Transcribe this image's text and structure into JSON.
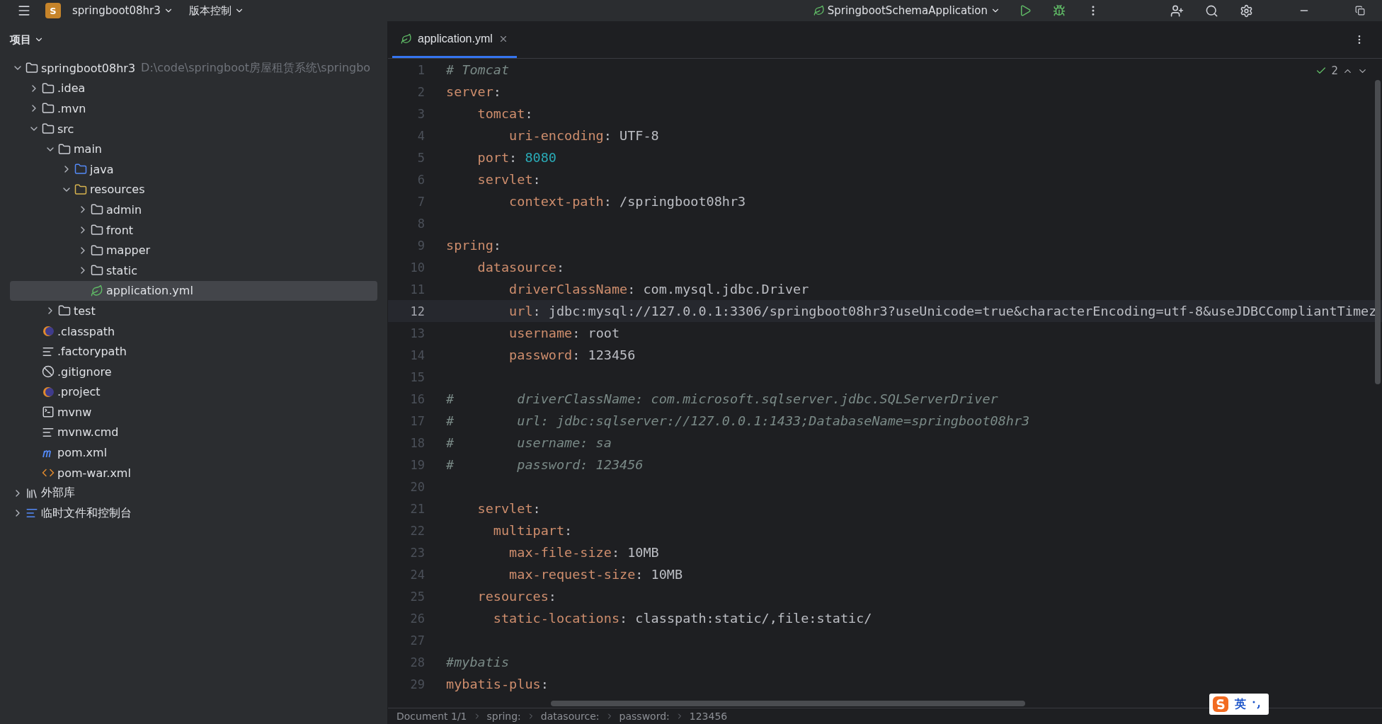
{
  "title_bar": {
    "project_badge": "S",
    "project": "springboot08hr3",
    "vcs": "版本控制",
    "run_config": "SpringbootSchemaApplication"
  },
  "sidebar": {
    "title": "项目",
    "tree": [
      {
        "label": "springboot08hr3",
        "hint": "D:\\code\\springboot房屋租赁系统\\springbo",
        "kind": "module",
        "expanded": true,
        "selected": false,
        "children": [
          {
            "label": ".idea",
            "kind": "folder",
            "expanded": false,
            "selected": false
          },
          {
            "label": ".mvn",
            "kind": "folder",
            "expanded": false,
            "selected": false
          },
          {
            "label": "src",
            "kind": "folder",
            "expanded": true,
            "selected": false,
            "children": [
              {
                "label": "main",
                "kind": "folder",
                "expanded": true,
                "selected": false,
                "children": [
                  {
                    "label": "java",
                    "kind": "source",
                    "expanded": false,
                    "selected": false
                  },
                  {
                    "label": "resources",
                    "kind": "resources",
                    "expanded": true,
                    "selected": false,
                    "children": [
                      {
                        "label": "admin",
                        "kind": "folder",
                        "expanded": false,
                        "selected": false
                      },
                      {
                        "label": "front",
                        "kind": "folder",
                        "expanded": false,
                        "selected": false
                      },
                      {
                        "label": "mapper",
                        "kind": "folder",
                        "expanded": false,
                        "selected": false
                      },
                      {
                        "label": "static",
                        "kind": "folder",
                        "expanded": false,
                        "selected": false
                      },
                      {
                        "label": "application.yml",
                        "kind": "yaml",
                        "selected": true
                      }
                    ]
                  }
                ]
              },
              {
                "label": "test",
                "kind": "folder",
                "expanded": false,
                "selected": false
              }
            ]
          },
          {
            "label": ".classpath",
            "kind": "eclipse",
            "selected": false
          },
          {
            "label": ".factorypath",
            "kind": "lines",
            "selected": false
          },
          {
            "label": ".gitignore",
            "kind": "ignore",
            "selected": false
          },
          {
            "label": ".project",
            "kind": "eclipse",
            "selected": false
          },
          {
            "label": "mvnw",
            "kind": "terminal",
            "selected": false
          },
          {
            "label": "mvnw.cmd",
            "kind": "lines",
            "selected": false
          },
          {
            "label": "pom.xml",
            "kind": "maven",
            "selected": false
          },
          {
            "label": "pom-war.xml",
            "kind": "xml",
            "selected": false
          }
        ]
      },
      {
        "label": "外部库",
        "kind": "library",
        "expanded": false,
        "selected": false
      },
      {
        "label": "临时文件和控制台",
        "kind": "scratch",
        "expanded": false,
        "selected": false
      }
    ]
  },
  "tabs": [
    {
      "label": "application.yml",
      "selected": true
    }
  ],
  "inspection": {
    "count": "2"
  },
  "code": [
    {
      "number": "1",
      "current": false,
      "tokens": [
        {
          "kind": "comment",
          "text": "# Tomcat"
        }
      ]
    },
    {
      "number": "2",
      "current": false,
      "tokens": [
        {
          "kind": "key",
          "text": "server"
        },
        {
          "kind": "punct",
          "text": ":"
        }
      ]
    },
    {
      "number": "3",
      "current": false,
      "tokens": [
        {
          "kind": "key",
          "text": "    tomcat"
        },
        {
          "kind": "punct",
          "text": ":"
        }
      ]
    },
    {
      "number": "4",
      "current": false,
      "tokens": [
        {
          "kind": "key",
          "text": "        uri-encoding"
        },
        {
          "kind": "punct",
          "text": ":"
        },
        {
          "kind": "value",
          "text": " UTF-8"
        }
      ]
    },
    {
      "number": "5",
      "current": false,
      "tokens": [
        {
          "kind": "key",
          "text": "    port"
        },
        {
          "kind": "punct",
          "text": ":"
        },
        {
          "kind": "number",
          "text": " 8080"
        }
      ]
    },
    {
      "number": "6",
      "current": false,
      "tokens": [
        {
          "kind": "key",
          "text": "    servlet"
        },
        {
          "kind": "punct",
          "text": ":"
        }
      ]
    },
    {
      "number": "7",
      "current": false,
      "tokens": [
        {
          "kind": "key",
          "text": "        context-path"
        },
        {
          "kind": "punct",
          "text": ":"
        },
        {
          "kind": "value",
          "text": " /springboot08hr3"
        }
      ]
    },
    {
      "number": "8",
      "current": false
    },
    {
      "number": "9",
      "current": false,
      "tokens": [
        {
          "kind": "key",
          "text": "spring"
        },
        {
          "kind": "punct",
          "text": ":"
        }
      ]
    },
    {
      "number": "10",
      "current": false,
      "tokens": [
        {
          "kind": "key",
          "text": "    datasource"
        },
        {
          "kind": "punct",
          "text": ":"
        }
      ]
    },
    {
      "number": "11",
      "current": false,
      "tokens": [
        {
          "kind": "key",
          "text": "        driverClassName"
        },
        {
          "kind": "punct",
          "text": ":"
        },
        {
          "kind": "value",
          "text": " com.mysql.jdbc.Driver"
        }
      ]
    },
    {
      "number": "12",
      "current": true,
      "tokens": [
        {
          "kind": "key",
          "text": "        url"
        },
        {
          "kind": "punct",
          "text": ":"
        },
        {
          "kind": "value",
          "text": " jdbc:mysql://127.0.0.1:3306/springboot08hr3?useUnicode=true&characterEncoding=utf-8&useJDBCCompliantTimez"
        }
      ]
    },
    {
      "number": "13",
      "current": false,
      "tokens": [
        {
          "kind": "key",
          "text": "        username"
        },
        {
          "kind": "punct",
          "text": ":"
        },
        {
          "kind": "value",
          "text": " root"
        }
      ]
    },
    {
      "number": "14",
      "current": false,
      "tokens": [
        {
          "kind": "key",
          "text": "        password"
        },
        {
          "kind": "punct",
          "text": ":"
        },
        {
          "kind": "value",
          "text": " 123456"
        }
      ]
    },
    {
      "number": "15",
      "current": false
    },
    {
      "number": "16",
      "current": false,
      "tokens": [
        {
          "kind": "comment",
          "text": "#        driverClassName: com.microsoft.sqlserver.jdbc.SQLServerDriver"
        }
      ]
    },
    {
      "number": "17",
      "current": false,
      "tokens": [
        {
          "kind": "comment",
          "text": "#        url: jdbc:sqlserver://127.0.0.1:1433;DatabaseName=springboot08hr3"
        }
      ]
    },
    {
      "number": "18",
      "current": false,
      "tokens": [
        {
          "kind": "comment",
          "text": "#        username: sa"
        }
      ]
    },
    {
      "number": "19",
      "current": false,
      "tokens": [
        {
          "kind": "comment",
          "text": "#        password: 123456"
        }
      ]
    },
    {
      "number": "20",
      "current": false
    },
    {
      "number": "21",
      "current": false,
      "tokens": [
        {
          "kind": "key",
          "text": "    servlet"
        },
        {
          "kind": "punct",
          "text": ":"
        }
      ]
    },
    {
      "number": "22",
      "current": false,
      "tokens": [
        {
          "kind": "key",
          "text": "      multipart"
        },
        {
          "kind": "punct",
          "text": ":"
        }
      ]
    },
    {
      "number": "23",
      "current": false,
      "tokens": [
        {
          "kind": "key",
          "text": "        max-file-size"
        },
        {
          "kind": "punct",
          "text": ":"
        },
        {
          "kind": "value",
          "text": " 10MB"
        }
      ]
    },
    {
      "number": "24",
      "current": false,
      "tokens": [
        {
          "kind": "key",
          "text": "        max-request-size"
        },
        {
          "kind": "punct",
          "text": ":"
        },
        {
          "kind": "value",
          "text": " 10MB"
        }
      ]
    },
    {
      "number": "25",
      "current": false,
      "tokens": [
        {
          "kind": "key",
          "text": "    resources"
        },
        {
          "kind": "punct",
          "text": ":"
        }
      ]
    },
    {
      "number": "26",
      "current": false,
      "tokens": [
        {
          "kind": "key",
          "text": "      static-locations"
        },
        {
          "kind": "punct",
          "text": ":"
        },
        {
          "kind": "value",
          "text": " classpath:static/,file:static/"
        }
      ]
    },
    {
      "number": "27",
      "current": false
    },
    {
      "number": "28",
      "current": false,
      "tokens": [
        {
          "kind": "comment",
          "text": "#mybatis"
        }
      ]
    },
    {
      "number": "29",
      "current": false,
      "tokens": [
        {
          "kind": "key",
          "text": "mybatis-plus"
        },
        {
          "kind": "punct",
          "text": ":"
        }
      ]
    }
  ],
  "breadcrumbs": [
    "Document 1/1",
    "spring:",
    "datasource:",
    "password:",
    "123456"
  ],
  "ime": {
    "language": "英"
  }
}
